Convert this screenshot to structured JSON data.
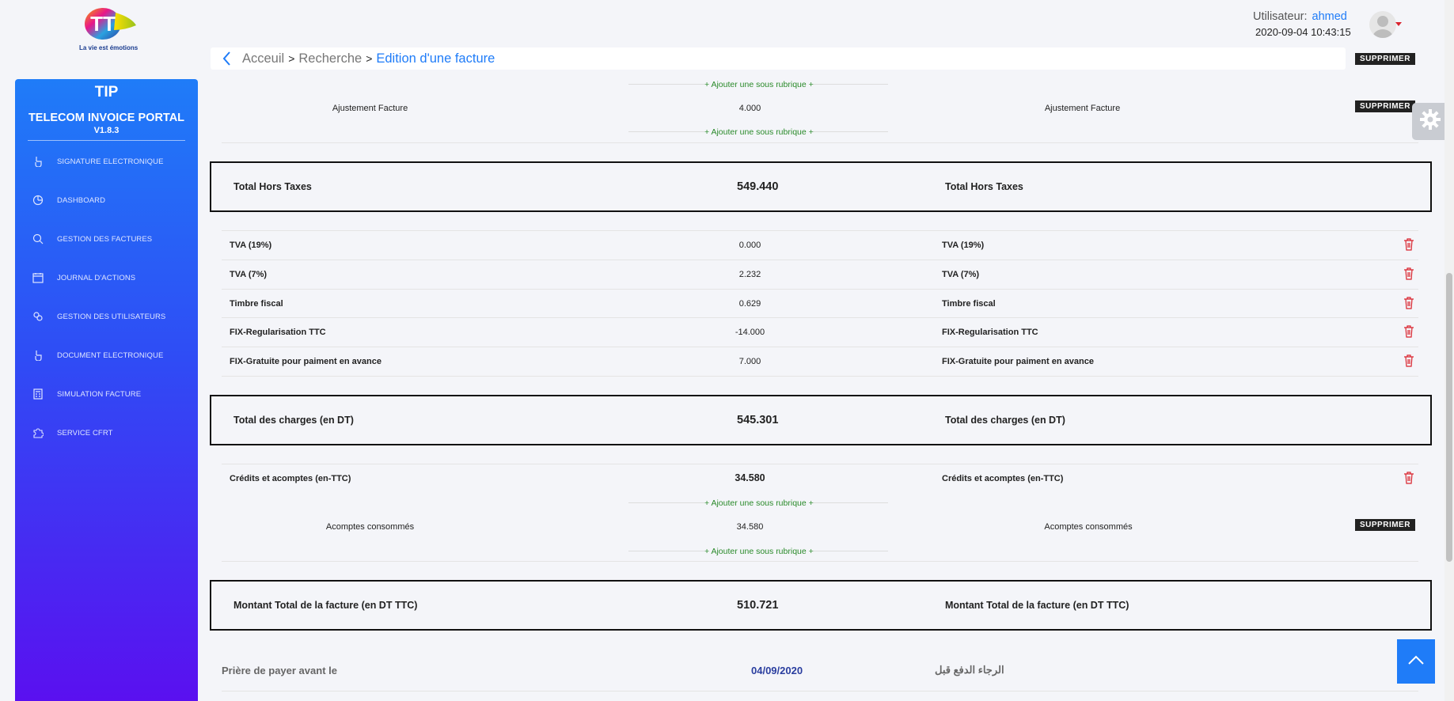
{
  "logo": {
    "text": "TT",
    "brand": "Tunisie Telecom",
    "tagline": "La vie est émotions"
  },
  "sidebar": {
    "title": "TIP",
    "subtitle": "TELECOM INVOICE PORTAL",
    "version": "V1.8.3",
    "items": [
      {
        "label": "SIGNATURE ELECTRONIQUE",
        "icon": "hand-pointer-icon"
      },
      {
        "label": "DASHBOARD",
        "icon": "pie-chart-icon"
      },
      {
        "label": "GESTION DES FACTURES",
        "icon": "search-icon"
      },
      {
        "label": "JOURNAL D'ACTIONS",
        "icon": "calendar-icon"
      },
      {
        "label": "GESTION DES UTILISATEURS",
        "icon": "users-icon"
      },
      {
        "label": "DOCUMENT ELECTRONIQUE",
        "icon": "hand-pointer-icon"
      },
      {
        "label": "SIMULATION FACTURE",
        "icon": "calculator-icon"
      },
      {
        "label": "SERVICE CFRT",
        "icon": "puzzle-icon"
      }
    ]
  },
  "header": {
    "user_label": "Utilisateur:",
    "username": "ahmed",
    "datetime": "2020-09-04 10:43:15"
  },
  "breadcrumb": {
    "home": "Acceuil",
    "search": "Recherche",
    "current": "Edition d'une facture",
    "separator": ">"
  },
  "actions": {
    "delete": "SUPPRIMER",
    "add_subsection": "+ Ajouter une sous rubrique +"
  },
  "invoice": {
    "adjustment": {
      "label": "Ajustement Facture",
      "value": "4.000",
      "label_right": "Ajustement Facture"
    },
    "total_ht": {
      "label": "Total Hors Taxes",
      "value": "549.440",
      "label_right": "Total Hors Taxes"
    },
    "taxes": [
      {
        "label": "TVA (19%)",
        "value": "0.000",
        "label_right": "TVA (19%)"
      },
      {
        "label": "TVA (7%)",
        "value": "2.232",
        "label_right": "TVA (7%)"
      },
      {
        "label": "Timbre fiscal",
        "value": "0.629",
        "label_right": "Timbre fiscal"
      },
      {
        "label": "FIX-Regularisation TTC",
        "value": "-14.000",
        "label_right": "FIX-Regularisation TTC"
      },
      {
        "label": "FIX-Gratuite pour paiment en avance",
        "value": "7.000",
        "label_right": "FIX-Gratuite pour paiment en avance"
      }
    ],
    "total_charges": {
      "label": "Total des charges (en DT)",
      "value": "545.301",
      "label_right": "Total des charges (en DT)"
    },
    "credits": {
      "label": "Crédits et acomptes (en-TTC)",
      "value": "34.580",
      "label_right": "Crédits et acomptes (en-TTC)"
    },
    "acomptes": {
      "label": "Acomptes consommés",
      "value": "34.580",
      "label_right": "Acomptes consommés"
    },
    "total_ttc": {
      "label": "Montant Total de la facture (en DT TTC)",
      "value": "510.721",
      "label_right": "Montant Total de la facture (en DT TTC)"
    },
    "payment": {
      "label": "Prière de payer avant le",
      "date": "04/09/2020",
      "label_arabic": "الرجاء الدفع قبل"
    }
  },
  "colors": {
    "accent": "#1f7cf8",
    "sidebar_bottom": "#5a10f0",
    "delete_icon": "#d9232d",
    "add_link": "#2a8a2a"
  }
}
